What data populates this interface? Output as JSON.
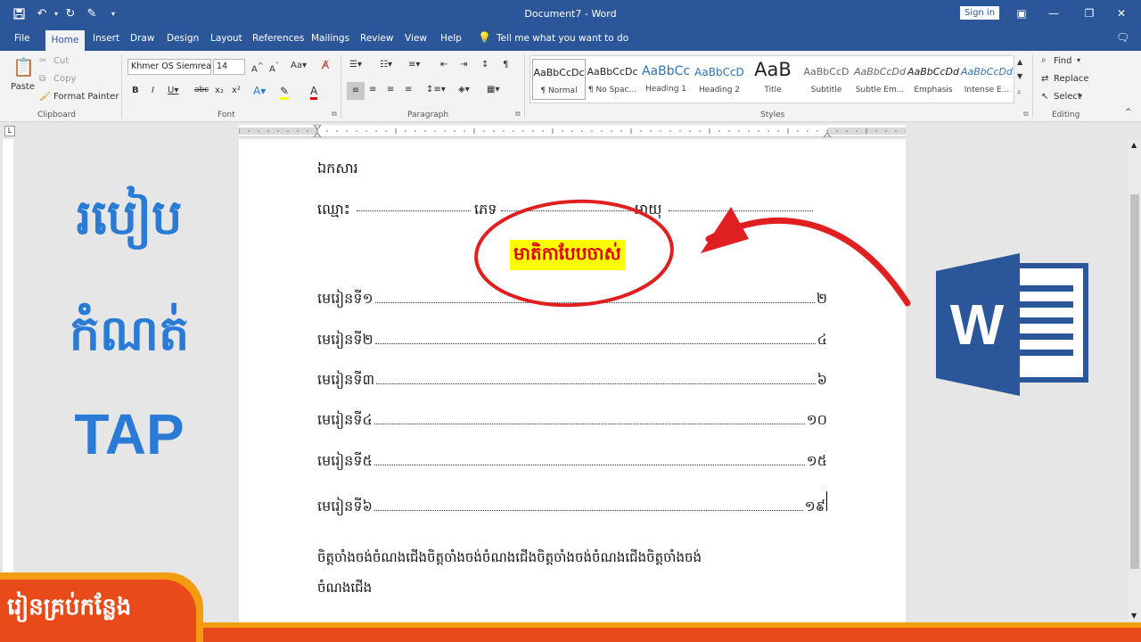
{
  "titlebar": {
    "title": "Document7 - Word",
    "signin": "Sign in"
  },
  "tabs": [
    "File",
    "Home",
    "Insert",
    "Draw",
    "Design",
    "Layout",
    "References",
    "Mailings",
    "Review",
    "View",
    "Help"
  ],
  "tell_me": "Tell me what you want to do",
  "clipboard": {
    "paste": "Paste",
    "cut": "Cut",
    "copy": "Copy",
    "format_painter": "Format Painter",
    "group": "Clipboard"
  },
  "font": {
    "name": "Khmer OS Siemreap",
    "size": "14",
    "group": "Font"
  },
  "paragraph": {
    "group": "Paragraph"
  },
  "styles": {
    "group": "Styles",
    "items": [
      {
        "preview": "AaBbCcDc",
        "name": "¶ Normal"
      },
      {
        "preview": "AaBbCcDc",
        "name": "¶ No Spac..."
      },
      {
        "preview": "AaBbCc",
        "name": "Heading 1"
      },
      {
        "preview": "AaBbCcD",
        "name": "Heading 2"
      },
      {
        "preview": "AaB",
        "name": "Title"
      },
      {
        "preview": "AaBbCcD",
        "name": "Subtitle"
      },
      {
        "preview": "AaBbCcDd",
        "name": "Subtle Em..."
      },
      {
        "preview": "AaBbCcDd",
        "name": "Emphasis"
      },
      {
        "preview": "AaBbCcDd",
        "name": "Intense E..."
      }
    ]
  },
  "editing": {
    "find": "Find",
    "replace": "Replace",
    "select": "Select",
    "group": "Editing"
  },
  "document": {
    "line1": "ឯកសារ",
    "line2_name": "ឈ្មោះ",
    "line2_gender": "ភេទ",
    "line2_age": "អាយុ",
    "heading": "មាតិកាបែបចាស់",
    "toc": [
      {
        "label": "មេរៀនទី១",
        "page": "២"
      },
      {
        "label": "មេរៀនទី២",
        "page": "៤"
      },
      {
        "label": "មេរៀនទី៣",
        "page": "៦"
      },
      {
        "label": "មេរៀនទី៤",
        "page": "១០"
      },
      {
        "label": "មេរៀនទី៥",
        "page": "១៥"
      },
      {
        "label": "មេរៀនទី៦",
        "page": "១៩"
      }
    ],
    "para_line1": "ចិត្តចាំងចង់ចំណងជើងចិត្តចាំងចង់ចំណងជើងចិត្តចាំងចង់ចំណងជើងចិត្តចាំងចង់",
    "para_line2": "ចំណងជើង"
  },
  "overlay": {
    "title_line1": "របៀប",
    "title_line2": "កំណត់",
    "title_line3": "TAP",
    "banner": "រៀនគ្រប់កន្លែង"
  },
  "colors": {
    "word_blue": "#2b579a",
    "accent_blue": "#2a7bd6",
    "highlight": "#ffff00",
    "heading_red": "#e00000",
    "annotation_red": "#e02020",
    "banner_orange": "#f39c12",
    "banner_red": "#e84a1a"
  }
}
